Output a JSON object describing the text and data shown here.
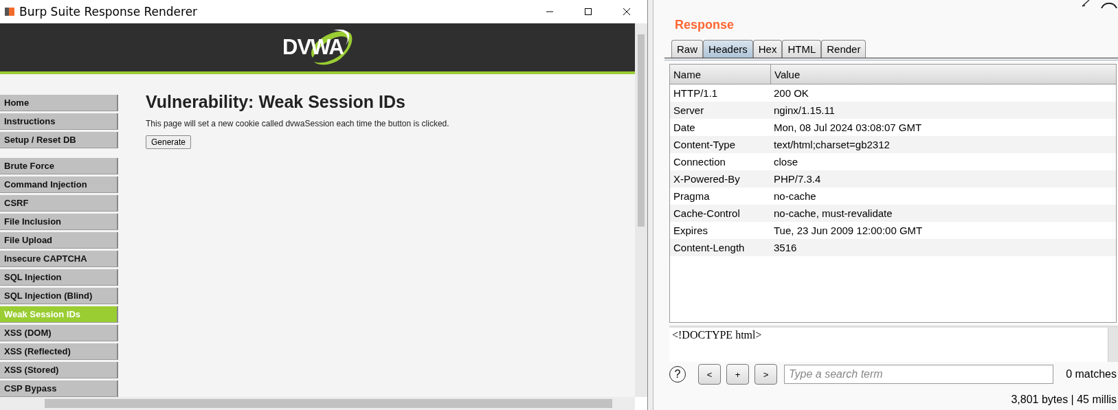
{
  "window": {
    "title": "Burp Suite Response Renderer"
  },
  "page": {
    "logo": "DVWA",
    "menu_groups": [
      {
        "items": [
          {
            "label": "Home",
            "selected": false
          },
          {
            "label": "Instructions",
            "selected": false
          },
          {
            "label": "Setup / Reset DB",
            "selected": false
          }
        ]
      },
      {
        "items": [
          {
            "label": "Brute Force",
            "selected": false
          },
          {
            "label": "Command Injection",
            "selected": false
          },
          {
            "label": "CSRF",
            "selected": false
          },
          {
            "label": "File Inclusion",
            "selected": false
          },
          {
            "label": "File Upload",
            "selected": false
          },
          {
            "label": "Insecure CAPTCHA",
            "selected": false
          },
          {
            "label": "SQL Injection",
            "selected": false
          },
          {
            "label": "SQL Injection (Blind)",
            "selected": false
          },
          {
            "label": "Weak Session IDs",
            "selected": true
          },
          {
            "label": "XSS (DOM)",
            "selected": false
          },
          {
            "label": "XSS (Reflected)",
            "selected": false
          },
          {
            "label": "XSS (Stored)",
            "selected": false
          },
          {
            "label": "CSP Bypass",
            "selected": false
          }
        ]
      }
    ],
    "heading": "Vulnerability: Weak Session IDs",
    "description": "This page will set a new cookie called dvwaSession each time the button is clicked.",
    "button": "Generate"
  },
  "response": {
    "title": "Response",
    "tabs": [
      {
        "label": "Raw",
        "selected": false
      },
      {
        "label": "Headers",
        "selected": true
      },
      {
        "label": "Hex",
        "selected": false
      },
      {
        "label": "HTML",
        "selected": false
      },
      {
        "label": "Render",
        "selected": false
      }
    ],
    "table": {
      "columns": [
        "Name",
        "Value"
      ],
      "rows": [
        [
          "HTTP/1.1",
          "200 OK"
        ],
        [
          "Server",
          "nginx/1.15.11"
        ],
        [
          "Date",
          "Mon, 08 Jul 2024 03:08:07 GMT"
        ],
        [
          "Content-Type",
          "text/html;charset=gb2312"
        ],
        [
          "Connection",
          "close"
        ],
        [
          "X-Powered-By",
          "PHP/7.3.4"
        ],
        [
          "Pragma",
          "no-cache"
        ],
        [
          "Cache-Control",
          "no-cache, must-revalidate"
        ],
        [
          "Expires",
          "Tue, 23 Jun 2009 12:00:00 GMT"
        ],
        [
          "Content-Length",
          "3516"
        ]
      ]
    },
    "raw_lines": [
      "<!DOCTYPE html>"
    ],
    "help": "?",
    "nav_buttons": [
      "<",
      "+",
      ">"
    ],
    "search": {
      "placeholder": "Type a search term"
    },
    "matches": "0 matches",
    "status": "3,801 bytes | 45 millis"
  }
}
